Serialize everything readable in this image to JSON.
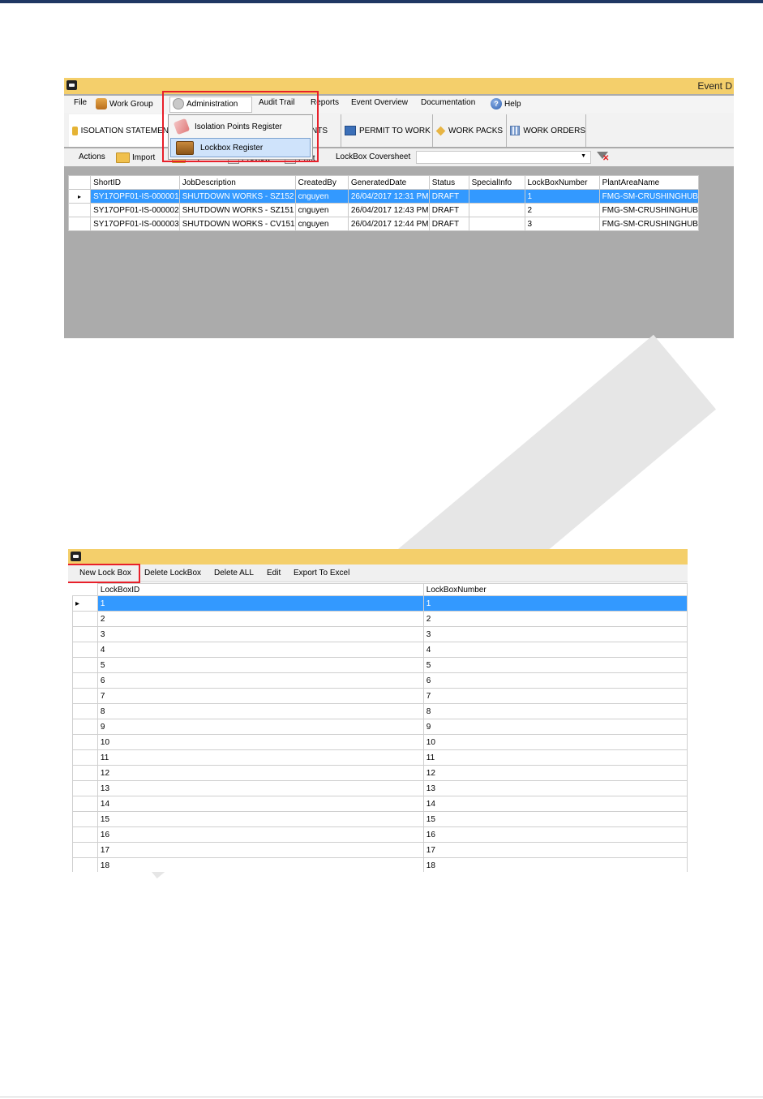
{
  "window1": {
    "title": "Event D",
    "menu": [
      {
        "label": "File"
      },
      {
        "label": "Work Group"
      },
      {
        "label": "Administration"
      },
      {
        "label": "Audit Trail"
      },
      {
        "label": "Reports"
      },
      {
        "label": "Event Overview"
      },
      {
        "label": "Documentation"
      },
      {
        "label": "Help"
      }
    ],
    "dropdown": [
      {
        "label": "Isolation Points Register"
      },
      {
        "label": "Lockbox Register"
      }
    ],
    "tabs": [
      {
        "label": "ISOLATION STATEMEN"
      },
      {
        "label": "MENTS"
      },
      {
        "label": "PERMIT TO WORK"
      },
      {
        "label": "WORK PACKS"
      },
      {
        "label": "WORK ORDERS"
      }
    ],
    "toolbar": {
      "actions": "Actions",
      "import": "Import",
      "export": "Export",
      "preview": "Preview",
      "print": "Print",
      "coversheet": "LockBox Coversheet",
      "combo_value": ""
    },
    "grid": {
      "columns": [
        "ShortID",
        "JobDescription",
        "CreatedBy",
        "GeneratedDate",
        "Status",
        "SpecialInfo",
        "LockBoxNumber",
        "PlantAreaName"
      ],
      "rows": [
        [
          "SY17OPF01-IS-000001",
          "SHUTDOWN WORKS - SZ152",
          "cnguyen",
          "26/04/2017 12:31 PM",
          "DRAFT",
          "",
          "1",
          "FMG-SM-CRUSHINGHUB"
        ],
        [
          "SY17OPF01-IS-000002",
          "SHUTDOWN WORKS - SZ151",
          "cnguyen",
          "26/04/2017 12:43 PM",
          "DRAFT",
          "",
          "2",
          "FMG-SM-CRUSHINGHUB"
        ],
        [
          "SY17OPF01-IS-000003",
          "SHUTDOWN WORKS - CV151",
          "cnguyen",
          "26/04/2017 12:44 PM",
          "DRAFT",
          "",
          "3",
          "FMG-SM-CRUSHINGHUB"
        ]
      ]
    },
    "row_indicator": "▸"
  },
  "window2": {
    "menu": [
      {
        "label": "New Lock Box"
      },
      {
        "label": "Delete LockBox"
      },
      {
        "label": "Delete ALL"
      },
      {
        "label": "Edit"
      },
      {
        "label": "Export To Excel"
      }
    ],
    "grid": {
      "columns": [
        "LockBoxID",
        "LockBoxNumber"
      ],
      "rows": [
        [
          "1",
          "1"
        ],
        [
          "2",
          "2"
        ],
        [
          "3",
          "3"
        ],
        [
          "4",
          "4"
        ],
        [
          "5",
          "5"
        ],
        [
          "6",
          "6"
        ],
        [
          "7",
          "7"
        ],
        [
          "8",
          "8"
        ],
        [
          "9",
          "9"
        ],
        [
          "10",
          "10"
        ],
        [
          "11",
          "11"
        ],
        [
          "12",
          "12"
        ],
        [
          "13",
          "13"
        ],
        [
          "14",
          "14"
        ],
        [
          "15",
          "15"
        ],
        [
          "16",
          "16"
        ],
        [
          "17",
          "17"
        ],
        [
          "18",
          "18"
        ]
      ]
    },
    "row_indicator": "▸"
  },
  "colors": {
    "titlebar": "#f4cf6b",
    "selection": "#3399ff",
    "highlight_box": "#e8202a",
    "header_strip": "#1f3763"
  }
}
